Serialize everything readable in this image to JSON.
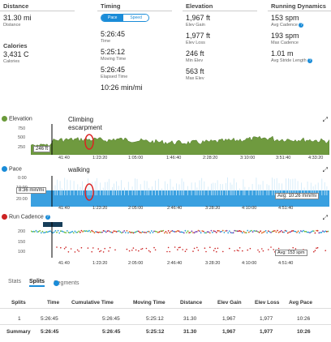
{
  "stats": {
    "distance": {
      "header": "Distance",
      "value": "31.30 mi",
      "label": "Distance"
    },
    "calories": {
      "header": "Calories",
      "value": "3,431 C",
      "label": "Calories"
    },
    "timing": {
      "header": "Timing",
      "toggle_left": "Pace",
      "toggle_right": "Speed",
      "items": [
        {
          "value": "5:26:45",
          "label": "Time"
        },
        {
          "value": "5:25:12",
          "label": "Moving Time"
        },
        {
          "value": "5:26:45",
          "label": "Elapsed Time"
        },
        {
          "value": "10:26 min/mi",
          "label": ""
        }
      ]
    },
    "elevation": {
      "header": "Elevation",
      "items": [
        {
          "value": "1,967 ft",
          "label": "Elev Gain"
        },
        {
          "value": "1,977 ft",
          "label": "Elev Loss"
        },
        {
          "value": "246 ft",
          "label": "Min Elev"
        },
        {
          "value": "563 ft",
          "label": "Max Elev"
        }
      ]
    },
    "running": {
      "header": "Running Dynamics",
      "items": [
        {
          "value": "153 spm",
          "label": "Avg Cadence"
        },
        {
          "value": "193 spm",
          "label": "Max Cadence"
        },
        {
          "value": "1.01 m",
          "label": "Avg Stride Length"
        }
      ]
    }
  },
  "charts": {
    "elevation": {
      "title": "Elevation",
      "color": "#6a9a3a",
      "yticks": [
        "750",
        "500",
        "250"
      ],
      "marker": "246 ft",
      "annotation_line1": "Climbing",
      "annotation_line2": "escarpment",
      "xticks": [
        "41:40",
        "1:23:20",
        "1:05:00",
        "1:46:40",
        "2:28:20",
        "3:10:00",
        "3:51:40",
        "4:33:20"
      ]
    },
    "pace": {
      "title": "Pace",
      "color": "#1a8cd8",
      "yticks": [
        "0:00",
        "10:00",
        "20:00"
      ],
      "marker": "8:36 min/mi",
      "avg": "Avg: 10:26 min/mi",
      "annotation": "walking",
      "xticks": [
        "41:40",
        "1:23:20",
        "2:05:00",
        "2:46:40",
        "3:28:20",
        "4:10:00",
        "4:51:40"
      ]
    },
    "cadence": {
      "title": "Run Cadence",
      "color": "#cc2222",
      "yticks": [
        "200",
        "150",
        "100"
      ],
      "marker": "",
      "avg": "Avg: 153 spm",
      "xticks": [
        "41:40",
        "1:23:20",
        "2:05:00",
        "2:46:40",
        "3:28:20",
        "4:10:00",
        "4:51:40"
      ]
    }
  },
  "tabs": [
    "Stats",
    "Splits",
    "Segments"
  ],
  "table": {
    "headers": [
      "Splits",
      "Time",
      "Cumulative Time",
      "Moving Time",
      "Distance",
      "Elev Gain",
      "Elev Loss",
      "Avg Pace"
    ],
    "rows": [
      [
        "1",
        "5:26:45",
        "5:26:45",
        "5:25:12",
        "31.30",
        "1,967",
        "1,977",
        "10:26"
      ]
    ],
    "summary": [
      "Summary",
      "5:26:45",
      "5:26:45",
      "5:25:12",
      "31.30",
      "1,967",
      "1,977",
      "10:26"
    ]
  }
}
